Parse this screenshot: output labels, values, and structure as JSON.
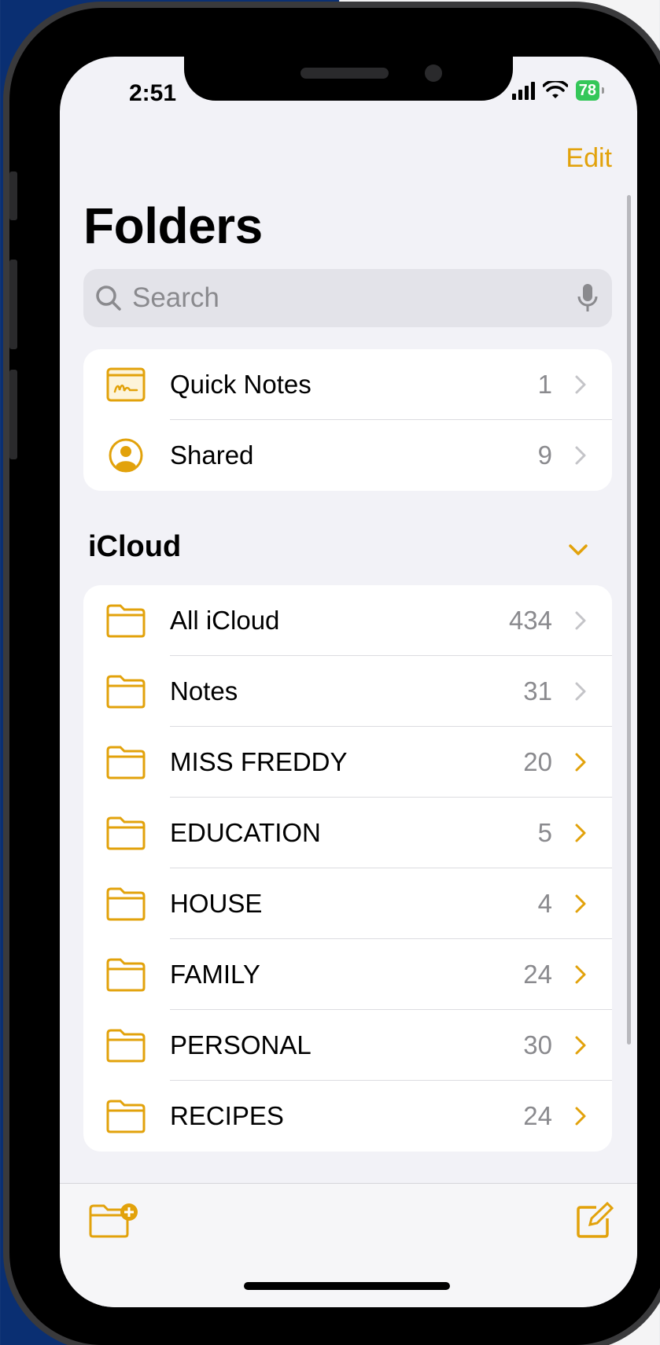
{
  "status_bar": {
    "time": "2:51",
    "battery": "78"
  },
  "nav": {
    "edit_label": "Edit",
    "title": "Folders"
  },
  "search": {
    "placeholder": "Search"
  },
  "pinned": [
    {
      "label": "Quick Notes",
      "count": "1",
      "icon": "quick-notes-icon"
    },
    {
      "label": "Shared",
      "count": "9",
      "icon": "shared-person-icon"
    }
  ],
  "icloud": {
    "title": "iCloud",
    "folders": [
      {
        "label": "All iCloud",
        "count": "434"
      },
      {
        "label": "Notes",
        "count": "31"
      },
      {
        "label": "MISS FREDDY",
        "count": "20"
      },
      {
        "label": "EDUCATION",
        "count": "5"
      },
      {
        "label": "HOUSE",
        "count": "4"
      },
      {
        "label": "FAMILY",
        "count": "24"
      },
      {
        "label": "PERSONAL",
        "count": "30"
      },
      {
        "label": "RECIPES",
        "count": "24"
      }
    ]
  },
  "colors": {
    "accent": "#e2a20b",
    "background": "#f2f2f7",
    "secondary_text": "#8a8a8e",
    "battery": "#34c759"
  }
}
